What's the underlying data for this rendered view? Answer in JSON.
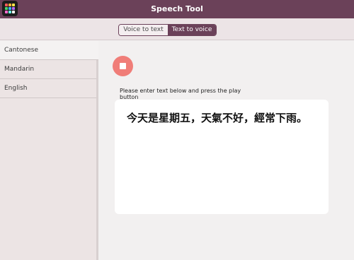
{
  "window": {
    "title": "Speech Tool",
    "app_icon": "app-grid-icon"
  },
  "mode_toggle": {
    "options": [
      {
        "label": "Voice to text",
        "selected": false
      },
      {
        "label": "Text to voice",
        "selected": true
      }
    ]
  },
  "sidebar": {
    "items": [
      {
        "label": "Cantonese",
        "active": true
      },
      {
        "label": "Mandarin",
        "active": false
      },
      {
        "label": "English",
        "active": false
      }
    ]
  },
  "main": {
    "stop_icon": "stop-icon",
    "instruction": "Please enter text below and press the play button",
    "text_input": "今天是星期五，天氣不好，經常下雨。"
  },
  "colors": {
    "titlebar": "#6b4159",
    "accent": "#6b4159",
    "stop_button": "#f07d78"
  }
}
